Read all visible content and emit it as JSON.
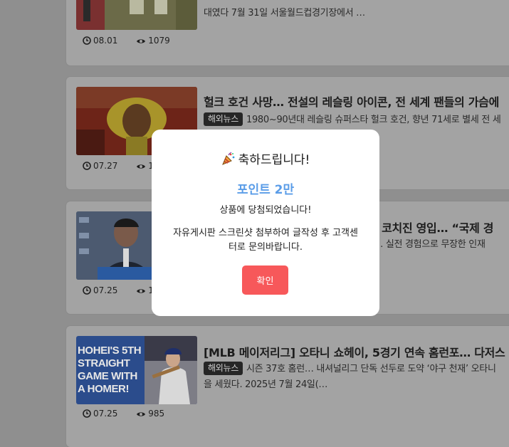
{
  "articles": [
    {
      "summary": "대였다 7월 31일 서울월드컵경기장에서 …",
      "date": "08.01",
      "views": "1079"
    },
    {
      "title": "헐크 호건 사망… 전설의 레슬링 아이콘, 전 세계 팬들의 가슴에",
      "badge": "해외뉴스",
      "summary": "1980~90년대 레슬링 슈퍼스타 헐크 호건, 향년 71세로 별세 전 세",
      "date": "07.27",
      "views": "11"
    },
    {
      "title": "투갈 코치진 영입… “국제 경",
      "summary": "합류… 실전 경험으로 무장한 인재",
      "date": "07.25",
      "views": "10"
    },
    {
      "title": "[MLB 메이저리그] 오타니 쇼헤이, 5경기 연속 홈런포… 다저스",
      "badge": "해외뉴스",
      "summary": "시즌 37호 홈런… 내셔널리그 단독 선두로 도약 ‘야구 천재’ 오타니",
      "summary2": "을 세웠다. 2025년 7월 24일(…",
      "date": "07.25",
      "views": "985",
      "thumb_text": [
        "HOHEI'S 5TH",
        "STRAIGHT",
        "GAME WITH",
        "A HOMER!"
      ]
    }
  ],
  "modal": {
    "heading": "축하드립니다!",
    "point": "포인트 2만",
    "won": "상품에 당첨되었습니다!",
    "guide": "자유게시판 스크린샷 첨부하여 글작성 후 고객센터로 문의바랍니다.",
    "confirm": "확인"
  },
  "colors": {
    "overlay": "#8f8f8f",
    "card": "#a3a3a3",
    "point": "#5b9de8",
    "confirm_button": "#f7585a"
  },
  "icons": [
    "clock-icon",
    "eye-icon",
    "party-popper-icon"
  ]
}
